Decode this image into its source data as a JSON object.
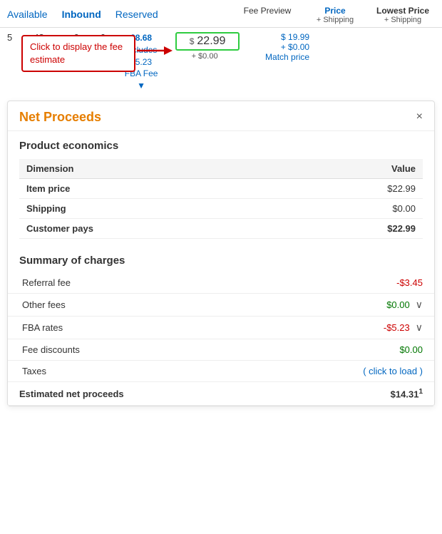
{
  "header": {
    "tab_available": "Available",
    "tab_inbound": "Inbound",
    "tab_reserved": "Reserved",
    "col_fee_preview": "Fee Preview",
    "col_price": "Price",
    "col_price_sub": "+ Shipping",
    "col_lowest": "Lowest Price",
    "col_lowest_sub": "+ Shipping"
  },
  "data_row": {
    "inventory_5": "5",
    "inventory_48": "48",
    "inventory_arrow": "▼",
    "inventory_0": "0",
    "inventory_0b": "0",
    "fee_amount": "$8.68",
    "fee_includes": "Includes",
    "fee_fba": "$5.23",
    "fee_fba_label": "FBA Fee",
    "fee_arrow": "▼",
    "price_dollar": "$",
    "price_amount": "22.99",
    "price_shipping": "+ $0.00",
    "lowest_price": "$ 19.99",
    "lowest_plus": "+ $0.00",
    "match_price": "Match price"
  },
  "click_box": {
    "text": "Click to display the fee estimate"
  },
  "net_proceeds": {
    "title": "Net Proceeds",
    "close": "×",
    "product_economics_title": "Product economics",
    "dimension_col": "Dimension",
    "value_col": "Value",
    "rows": [
      {
        "dimension": "Item price",
        "value": "$22.99"
      },
      {
        "dimension": "Shipping",
        "value": "$0.00"
      },
      {
        "dimension": "Customer pays",
        "value": "$22.99"
      }
    ],
    "charges_title": "Summary of charges",
    "charges": [
      {
        "label": "Referral fee",
        "value": "-$3.45",
        "type": "negative",
        "has_chevron": false
      },
      {
        "label": "Other fees",
        "value": "$0.00",
        "type": "zero-green",
        "has_chevron": true
      },
      {
        "label": "FBA rates",
        "value": "-$5.23",
        "type": "negative",
        "has_chevron": true
      },
      {
        "label": "Fee discounts",
        "value": "$0.00",
        "type": "zero-green",
        "has_chevron": false
      },
      {
        "label": "Taxes",
        "value": "( click to load )",
        "type": "click-to-load",
        "has_chevron": false
      },
      {
        "label": "Estimated net proceeds",
        "value": "$14.31",
        "superscript": "1",
        "type": "bold",
        "has_chevron": false
      }
    ]
  }
}
